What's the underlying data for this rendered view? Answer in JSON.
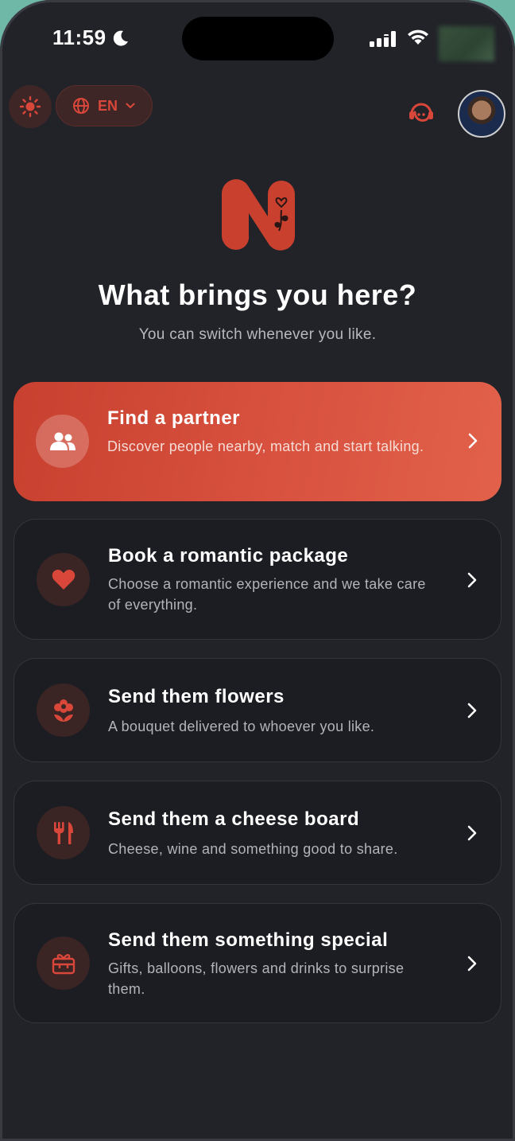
{
  "status_bar": {
    "time": "11:59"
  },
  "header": {
    "language": "EN"
  },
  "main": {
    "title": "What brings you here?",
    "subtitle": "You can switch whenever you like."
  },
  "options": [
    {
      "title": "Find a partner",
      "description": "Discover people nearby, match and start talking.",
      "icon": "people-icon"
    },
    {
      "title": "Book a romantic package",
      "description": "Choose a romantic experience and we take care of everything.",
      "icon": "heart-icon"
    },
    {
      "title": "Send them flowers",
      "description": "A bouquet delivered to whoever you like.",
      "icon": "flower-icon"
    },
    {
      "title": "Send them a cheese board",
      "description": "Cheese, wine and something good to share.",
      "icon": "utensils-icon"
    },
    {
      "title": "Send them something special",
      "description": "Gifts, balloons, flowers and drinks to surprise them.",
      "icon": "gift-icon"
    }
  ],
  "colors": {
    "accent": "#d9473a",
    "background": "#222329",
    "card": "#1c1d22"
  }
}
